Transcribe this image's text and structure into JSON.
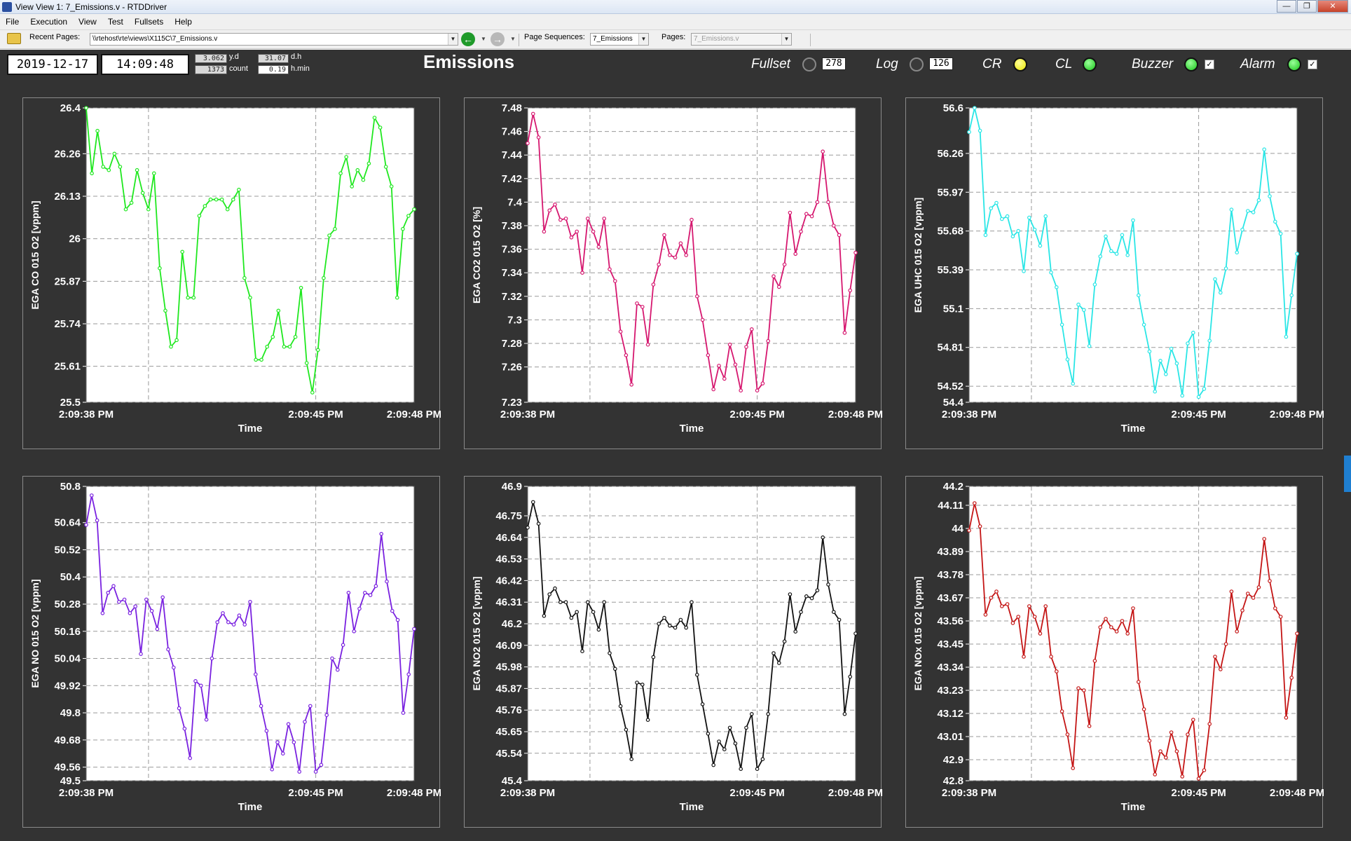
{
  "window": {
    "title": "View View 1: 7_Emissions.v - RTDDriver",
    "buttons": {
      "minimize": "—",
      "maximize": "❐",
      "close": "✕"
    }
  },
  "menu": [
    "File",
    "Execution",
    "View",
    "Test",
    "Fullsets",
    "Help"
  ],
  "toolbar": {
    "recent_pages_label": "Recent Pages:",
    "recent_pages_value": "\\\\rtehost\\rte\\views\\X115C\\7_Emissions.v",
    "page_sequences_label": "Page Sequences:",
    "page_sequences_value": "7_Emissions",
    "pages_label": "Pages:",
    "pages_value": "7_Emissions.v"
  },
  "header": {
    "date": "2019-12-17",
    "time": "14:09:48",
    "yd_value": "3.062",
    "yd_label": "y.d",
    "dh_value": "31.07",
    "dh_label": "d.h",
    "count_value": "1373",
    "count_label": "count",
    "hmin_value": "0.19",
    "hmin_label": "h.min",
    "page_title": "Emissions",
    "indicators": {
      "fullset_label": "Fullset",
      "fullset_count": "278",
      "log_label": "Log",
      "log_count": "126",
      "cr_label": "CR",
      "cl_label": "CL",
      "buzzer_label": "Buzzer",
      "alarm_label": "Alarm"
    },
    "colors": {
      "cr": "#f2ef1a",
      "cl": "#19c519",
      "buzzer": "#19c519",
      "alarm": "#19c519"
    }
  },
  "chart_data": [
    {
      "type": "line",
      "ylabel": "EGA CO 015 O2 [vppm]",
      "xlabel": "Time",
      "color": "#1fe81f",
      "yticks": [
        "26.4",
        "26.26",
        "26.13",
        "26",
        "25.87",
        "25.74",
        "25.61",
        "25.5"
      ],
      "ylim": [
        25.5,
        26.4
      ],
      "xticks": [
        "2:09:38 PM",
        "2:09:45 PM",
        "2:09:48 PM"
      ],
      "values": [
        26.4,
        26.2,
        26.33,
        26.22,
        26.21,
        26.26,
        26.22,
        26.09,
        26.11,
        26.21,
        26.14,
        26.09,
        26.2,
        25.91,
        25.78,
        25.67,
        25.69,
        25.96,
        25.82,
        25.82,
        26.07,
        26.1,
        26.12,
        26.12,
        26.12,
        26.09,
        26.12,
        26.15,
        25.88,
        25.82,
        25.63,
        25.63,
        25.67,
        25.7,
        25.78,
        25.67,
        25.67,
        25.7,
        25.85,
        25.62,
        25.53,
        25.66,
        25.88,
        26.01,
        26.03,
        26.2,
        26.25,
        26.16,
        26.21,
        26.18,
        26.23,
        26.37,
        26.34,
        26.22,
        26.16,
        25.82,
        26.03,
        26.07,
        26.09
      ]
    },
    {
      "type": "line",
      "ylabel": "EGA CO2 015 O2 [%]",
      "xlabel": "Time",
      "color": "#d6176f",
      "yticks": [
        "7.48",
        "7.46",
        "7.44",
        "7.42",
        "7.4",
        "7.38",
        "7.36",
        "7.34",
        "7.32",
        "7.3",
        "7.28",
        "7.26",
        "7.23"
      ],
      "ylim": [
        7.23,
        7.48
      ],
      "xticks": [
        "2:09:38 PM",
        "2:09:45 PM",
        "2:09:48 PM"
      ],
      "values": [
        7.45,
        7.475,
        7.455,
        7.375,
        7.393,
        7.398,
        7.385,
        7.386,
        7.37,
        7.375,
        7.34,
        7.386,
        7.375,
        7.362,
        7.386,
        7.343,
        7.333,
        7.29,
        7.27,
        7.245,
        7.314,
        7.311,
        7.279,
        7.33,
        7.347,
        7.372,
        7.355,
        7.353,
        7.365,
        7.355,
        7.385,
        7.32,
        7.3,
        7.27,
        7.241,
        7.261,
        7.25,
        7.279,
        7.262,
        7.24,
        7.277,
        7.292,
        7.24,
        7.246,
        7.282,
        7.337,
        7.328,
        7.347,
        7.391,
        7.356,
        7.375,
        7.39,
        7.388,
        7.4,
        7.443,
        7.4,
        7.38,
        7.372,
        7.289,
        7.325,
        7.357
      ]
    },
    {
      "type": "line",
      "ylabel": "EGA UHC 015 O2 [vppm]",
      "xlabel": "Time",
      "color": "#2ae6e6",
      "yticks": [
        "56.6",
        "56.26",
        "55.97",
        "55.68",
        "55.39",
        "55.1",
        "54.81",
        "54.52",
        "54.4"
      ],
      "ylim": [
        54.4,
        56.6
      ],
      "xticks": [
        "2:09:38 PM",
        "2:09:45 PM",
        "2:09:48 PM"
      ],
      "values": [
        56.42,
        56.6,
        56.43,
        55.65,
        55.85,
        55.89,
        55.77,
        55.79,
        55.64,
        55.68,
        55.38,
        55.78,
        55.69,
        55.57,
        55.79,
        55.37,
        55.26,
        54.98,
        54.72,
        54.54,
        55.13,
        55.09,
        54.82,
        55.28,
        55.49,
        55.64,
        55.53,
        55.51,
        55.65,
        55.5,
        55.76,
        55.2,
        54.98,
        54.78,
        54.48,
        54.71,
        54.61,
        54.8,
        54.69,
        54.45,
        54.84,
        54.92,
        54.44,
        54.5,
        54.86,
        55.32,
        55.22,
        55.4,
        55.84,
        55.52,
        55.69,
        55.83,
        55.82,
        55.91,
        56.29,
        55.94,
        55.75,
        55.66,
        54.89,
        55.2,
        55.51
      ]
    },
    {
      "type": "line",
      "ylabel": "EGA NO 015 O2 [vppm]",
      "xlabel": "Time",
      "color": "#7a22e0",
      "yticks": [
        "50.8",
        "50.64",
        "50.52",
        "50.4",
        "50.28",
        "50.16",
        "50.04",
        "49.92",
        "49.8",
        "49.68",
        "49.56",
        "49.5"
      ],
      "ylim": [
        49.5,
        50.8
      ],
      "xticks": [
        "2:09:38 PM",
        "2:09:45 PM",
        "2:09:48 PM"
      ],
      "values": [
        50.63,
        50.76,
        50.65,
        50.24,
        50.33,
        50.36,
        50.29,
        50.3,
        50.24,
        50.27,
        50.06,
        50.3,
        50.25,
        50.17,
        50.31,
        50.08,
        50.0,
        49.82,
        49.73,
        49.6,
        49.94,
        49.92,
        49.77,
        50.04,
        50.2,
        50.24,
        50.2,
        50.19,
        50.23,
        50.19,
        50.29,
        49.97,
        49.83,
        49.72,
        49.55,
        49.67,
        49.62,
        49.75,
        49.67,
        49.54,
        49.76,
        49.83,
        49.54,
        49.57,
        49.79,
        50.04,
        49.99,
        50.1,
        50.33,
        50.16,
        50.26,
        50.33,
        50.32,
        50.36,
        50.59,
        50.38,
        50.25,
        50.21,
        49.8,
        49.97,
        50.17
      ]
    },
    {
      "type": "line",
      "ylabel": "EGA NO2 015 O2 [vppm]",
      "xlabel": "Time",
      "color": "#111111",
      "yticks": [
        "46.9",
        "46.75",
        "46.64",
        "46.53",
        "46.42",
        "46.31",
        "46.2",
        "46.09",
        "45.98",
        "45.87",
        "45.76",
        "45.65",
        "45.54",
        "45.4"
      ],
      "ylim": [
        45.4,
        46.9
      ],
      "xticks": [
        "2:09:38 PM",
        "2:09:45 PM",
        "2:09:48 PM"
      ],
      "values": [
        46.69,
        46.82,
        46.71,
        46.24,
        46.35,
        46.38,
        46.31,
        46.31,
        46.23,
        46.26,
        46.06,
        46.31,
        46.26,
        46.17,
        46.31,
        46.05,
        45.97,
        45.78,
        45.66,
        45.51,
        45.9,
        45.89,
        45.71,
        46.03,
        46.2,
        46.23,
        46.19,
        46.18,
        46.22,
        46.18,
        46.31,
        45.94,
        45.79,
        45.64,
        45.48,
        45.6,
        45.56,
        45.67,
        45.59,
        45.46,
        45.67,
        45.74,
        45.46,
        45.51,
        45.74,
        46.05,
        46.0,
        46.11,
        46.35,
        46.16,
        46.26,
        46.34,
        46.33,
        46.37,
        46.64,
        46.4,
        46.26,
        46.22,
        45.74,
        45.93,
        46.15
      ]
    },
    {
      "type": "line",
      "ylabel": "EGA NOx 015 O2 [vppm]",
      "xlabel": "Time",
      "color": "#c41515",
      "yticks": [
        "44.2",
        "44.11",
        "44",
        "43.89",
        "43.78",
        "43.67",
        "43.56",
        "43.45",
        "43.34",
        "43.23",
        "43.12",
        "43.01",
        "42.9",
        "42.8"
      ],
      "ylim": [
        42.8,
        44.2
      ],
      "xticks": [
        "2:09:38 PM",
        "2:09:45 PM",
        "2:09:48 PM"
      ],
      "values": [
        43.99,
        44.12,
        44.01,
        43.59,
        43.67,
        43.7,
        43.63,
        43.64,
        43.55,
        43.58,
        43.39,
        43.63,
        43.58,
        43.5,
        43.63,
        43.39,
        43.32,
        43.13,
        43.02,
        42.86,
        43.24,
        43.23,
        43.06,
        43.37,
        43.53,
        43.57,
        43.53,
        43.51,
        43.56,
        43.5,
        43.62,
        43.27,
        43.14,
        42.99,
        42.83,
        42.94,
        42.91,
        43.03,
        42.94,
        42.82,
        43.02,
        43.09,
        42.81,
        42.85,
        43.07,
        43.39,
        43.33,
        43.45,
        43.7,
        43.51,
        43.61,
        43.69,
        43.67,
        43.72,
        43.95,
        43.75,
        43.62,
        43.58,
        43.1,
        43.29,
        43.5
      ]
    }
  ]
}
